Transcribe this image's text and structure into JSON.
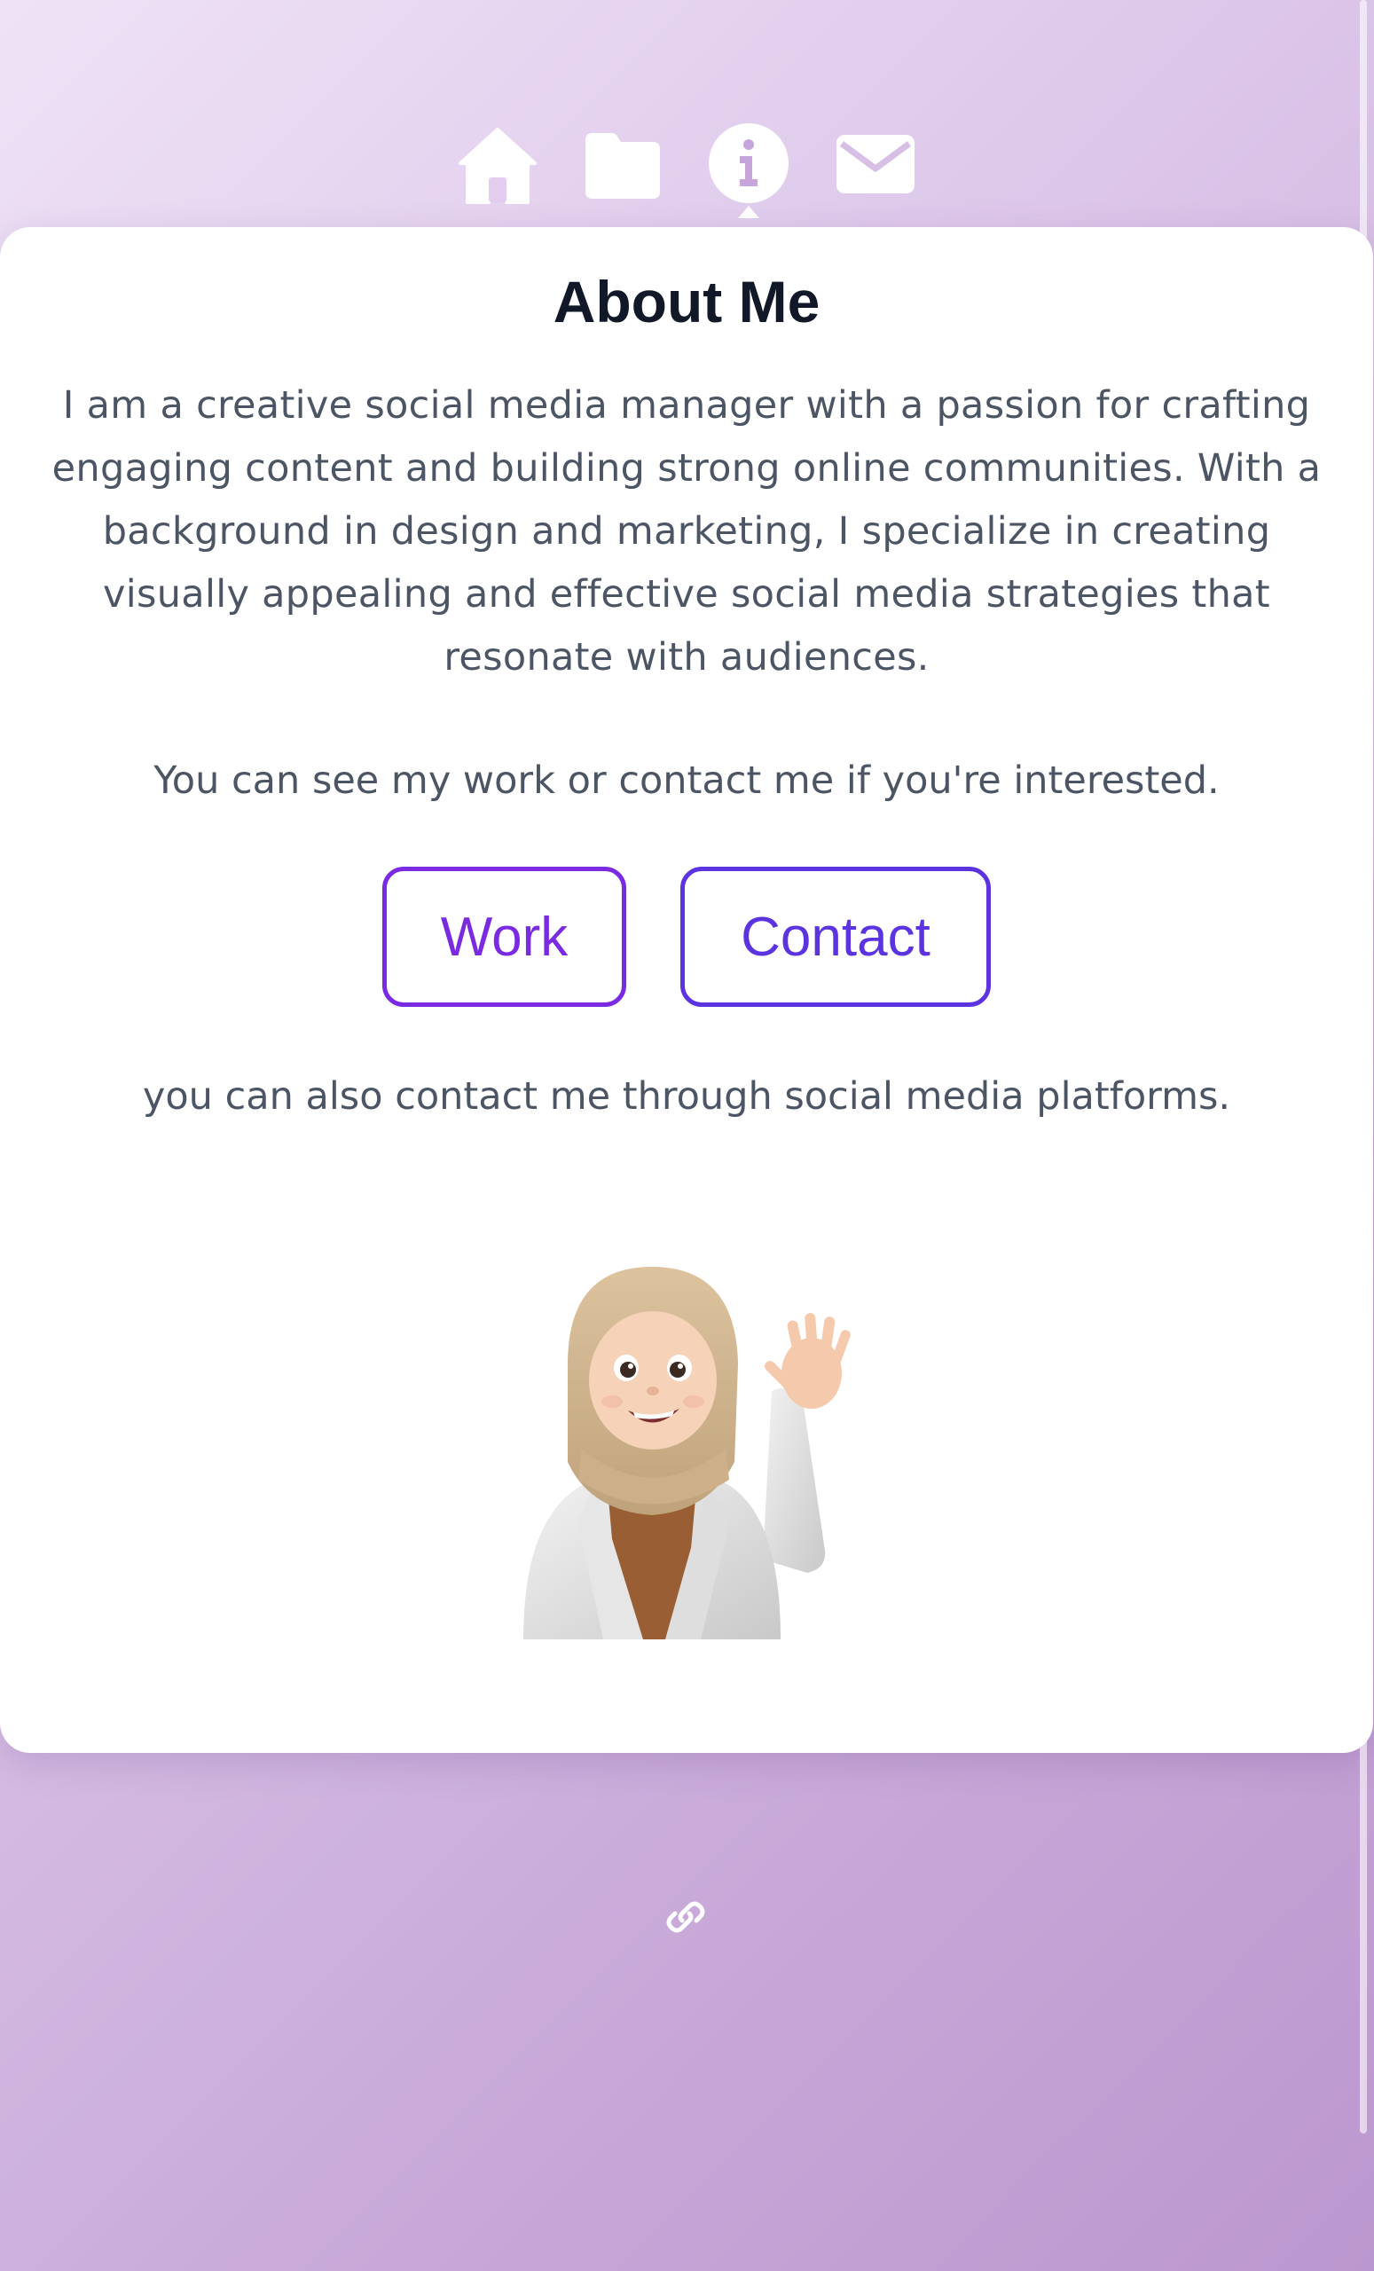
{
  "nav": {
    "items": [
      {
        "icon": "home-icon",
        "active": false
      },
      {
        "icon": "folder-icon",
        "active": false
      },
      {
        "icon": "info-icon",
        "active": true
      },
      {
        "icon": "envelope-icon",
        "active": false
      }
    ]
  },
  "about": {
    "title": "About Me",
    "bio": "I am a creative social media manager with a passion for crafting engaging content and building strong online communities. With a background in design and marketing, I specialize in creating visually appealing and effective social media strategies that resonate with audiences.",
    "invite": "You can see my work or contact me if you're interested.",
    "buttons": {
      "work_label": "Work",
      "contact_label": "Contact"
    },
    "social_note": "you can also contact me through social media platforms.",
    "avatar_icon": "waving-avatar"
  },
  "footer": {
    "link_icon": "link-icon"
  },
  "colors": {
    "accent_work": "#7a2be2",
    "accent_contact": "#5b34e0",
    "title": "#111827",
    "body_text": "#4b5563"
  }
}
